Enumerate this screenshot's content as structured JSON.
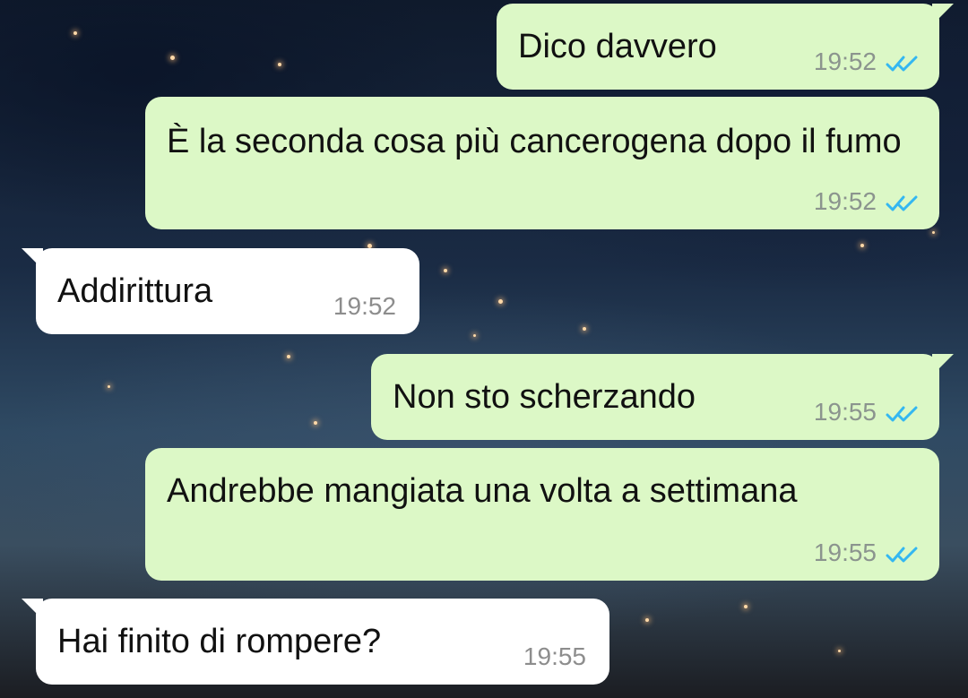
{
  "background": {
    "accent_colors": [
      "#0f1a2c",
      "#2f4a63",
      "#ffd9a8"
    ]
  },
  "messages": [
    {
      "direction": "outgoing",
      "text": "Dico davvero",
      "time": "19:52",
      "status_icon": "double-check-icon",
      "status_color": "#34b7f1"
    },
    {
      "direction": "outgoing",
      "text": "È la seconda cosa più cancerogena dopo il fumo",
      "time": "19:52",
      "status_icon": "double-check-icon",
      "status_color": "#34b7f1"
    },
    {
      "direction": "incoming",
      "text": "Addirittura",
      "time": "19:52"
    },
    {
      "direction": "outgoing",
      "text": "Non sto scherzando",
      "time": "19:55",
      "status_icon": "double-check-icon",
      "status_color": "#34b7f1"
    },
    {
      "direction": "outgoing",
      "text": "Andrebbe mangiata una volta a settimana",
      "time": "19:55",
      "status_icon": "double-check-icon",
      "status_color": "#34b7f1"
    },
    {
      "direction": "incoming",
      "text": "Hai finito di rompere?",
      "time": "19:55"
    }
  ]
}
